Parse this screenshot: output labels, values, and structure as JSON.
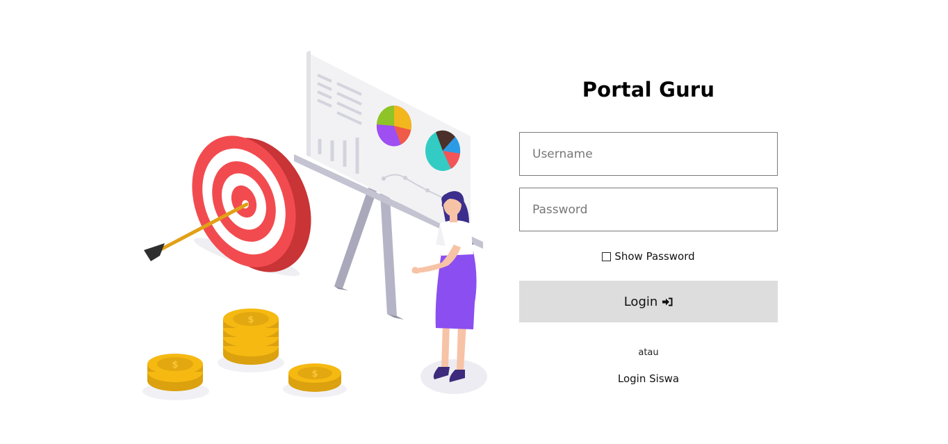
{
  "portal": {
    "title": "Portal Guru"
  },
  "form": {
    "username_placeholder": "Username",
    "password_placeholder": "Password",
    "show_password_label": "Show Password",
    "login_label": "Login",
    "login_icon": "sign-in-icon",
    "separator": "atau",
    "student_login_link": "Login Siswa"
  },
  "illustration": {
    "name": "presentation-target-coins-illustration",
    "coin_symbol": "$"
  },
  "colors": {
    "button_bg": "#dddddd",
    "input_border": "#7a7a7a",
    "target_red": "#f24b4f",
    "coin_gold": "#f5b912",
    "dress_purple": "#8b4ef0"
  }
}
